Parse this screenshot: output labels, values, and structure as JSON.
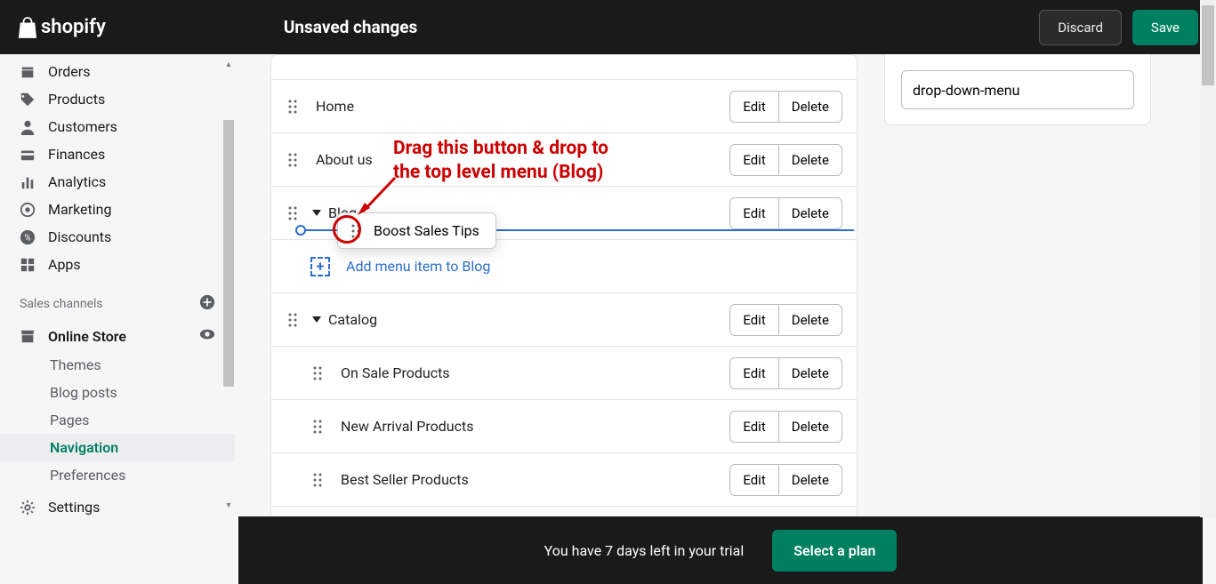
{
  "topbar": {
    "brand": "shopify",
    "title": "Unsaved changes",
    "discard": "Discard",
    "save": "Save"
  },
  "sidebar": {
    "items": [
      {
        "label": "Orders"
      },
      {
        "label": "Products"
      },
      {
        "label": "Customers"
      },
      {
        "label": "Finances"
      },
      {
        "label": "Analytics"
      },
      {
        "label": "Marketing"
      },
      {
        "label": "Discounts"
      },
      {
        "label": "Apps"
      }
    ],
    "sales_channels_label": "Sales channels",
    "online_store": "Online Store",
    "sub": [
      "Themes",
      "Blog posts",
      "Pages",
      "Navigation",
      "Preferences"
    ],
    "settings": "Settings"
  },
  "menu": {
    "rows": [
      {
        "label": "Home"
      },
      {
        "label": "About us"
      },
      {
        "label": "Blog",
        "expandable": true
      },
      {
        "label": "Catalog",
        "expandable": true
      }
    ],
    "catalog_children": [
      {
        "label": "On Sale Products"
      },
      {
        "label": "New Arrival Products"
      },
      {
        "label": "Best Seller Products"
      }
    ],
    "add_label": "Add menu item to Blog",
    "dragging_label": "Boost Sales Tips",
    "edit": "Edit",
    "delete": "Delete"
  },
  "side_card": {
    "handle_value": "drop-down-menu"
  },
  "footer": {
    "trial": "You have 7 days left in your trial",
    "plan": "Select a plan"
  },
  "annotation": {
    "line1": "Drag this button & drop to",
    "line2": "the top level menu (Blog)"
  }
}
